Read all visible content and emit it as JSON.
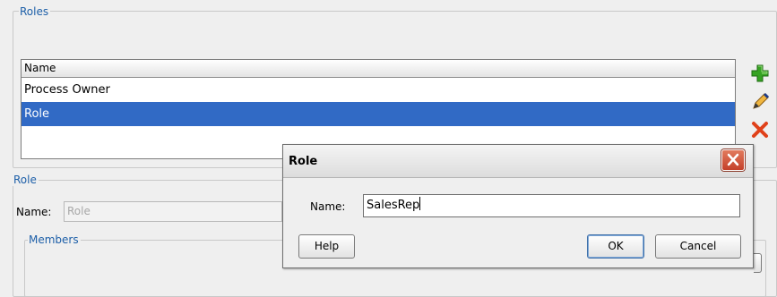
{
  "roles_panel": {
    "legend": "Roles",
    "table_header": "Name",
    "rows": [
      "Process Owner",
      "Role"
    ]
  },
  "toolbar": {
    "add_icon": "plus-icon",
    "edit_icon": "pencil-icon",
    "delete_icon": "delete-x-icon",
    "colors": {
      "add": "#2f9a1c",
      "edit": "#d39a2a",
      "delete": "#e0411a"
    }
  },
  "role_panel": {
    "legend": "Role",
    "name_label": "Name:",
    "name_value": "Role",
    "members_legend": "Members"
  },
  "dialog": {
    "title": "Role",
    "name_label": "Name:",
    "name_value": "SalesRep",
    "help_label": "Help",
    "ok_label": "OK",
    "cancel_label": "Cancel"
  },
  "colors": {
    "selection": "#316ac5",
    "legend_text": "#1d5fa8"
  }
}
